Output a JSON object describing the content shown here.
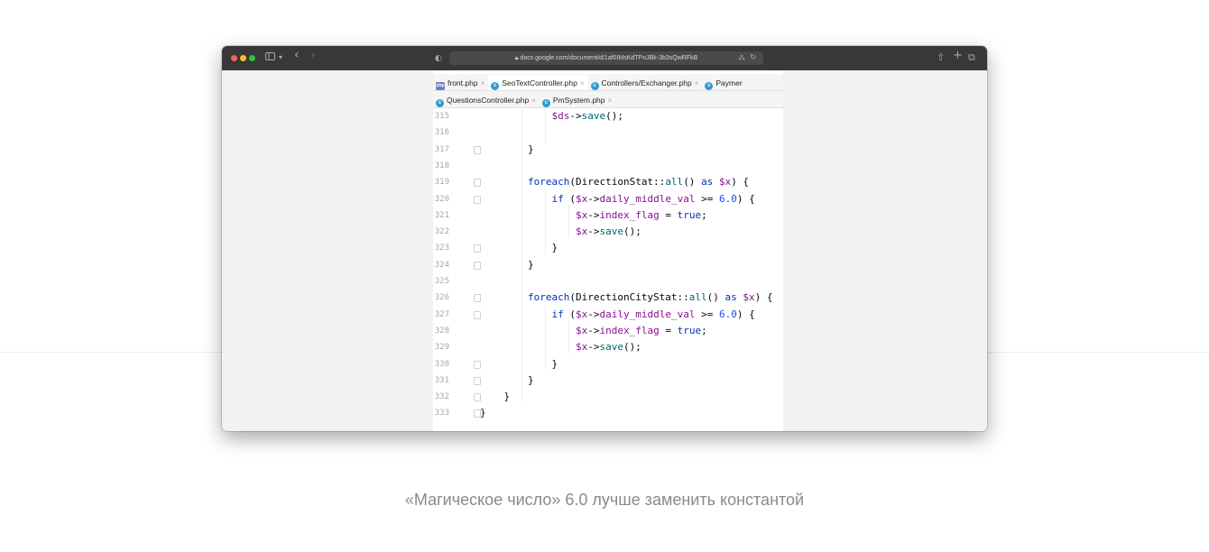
{
  "browser": {
    "url": "docs.google.com/document/d/1af0IMsKdTPoJBk-3b3sQwRFkB",
    "controls": {
      "sidebar_icon": "sidebar-icon",
      "chevron": "▾",
      "back": "‹",
      "forward": "›",
      "privacy": "◐",
      "translate": "⁂",
      "reload": "↻",
      "share": "⇪",
      "new_tab": "+",
      "tabs": "⧉"
    }
  },
  "ide": {
    "tabs_row1": [
      {
        "label": "front.php",
        "icon": "php-file-icon",
        "active": false
      },
      {
        "label": "SeoTextController.php",
        "icon": "class-icon",
        "active": true
      },
      {
        "label": "Controllers/Exchanger.php",
        "icon": "class-icon",
        "active": false
      },
      {
        "label": "Paymer",
        "icon": "class-icon",
        "active": false
      }
    ],
    "tabs_row2": [
      {
        "label": "QuestionsController.php",
        "icon": "class-icon",
        "active": false
      },
      {
        "label": "PmSystem.php",
        "icon": "class-icon",
        "active": false
      }
    ],
    "php_icon_text": "php",
    "class_icon_text": "c",
    "close_glyph": "×",
    "code_lines": [
      {
        "n": "315",
        "segs": [
          [
            "            ",
            ""
          ],
          [
            "$ds",
            "v"
          ],
          [
            "->",
            ""
          ],
          [
            "save",
            "m"
          ],
          [
            "();",
            ""
          ]
        ]
      },
      {
        "n": "316",
        "segs": []
      },
      {
        "n": "317",
        "segs": [
          [
            "        }",
            ""
          ]
        ]
      },
      {
        "n": "318",
        "segs": []
      },
      {
        "n": "319",
        "segs": [
          [
            "        ",
            ""
          ],
          [
            "foreach",
            "kw"
          ],
          [
            "(DirectionStat::",
            ""
          ],
          [
            "all",
            "m"
          ],
          [
            "() ",
            ""
          ],
          [
            "as",
            "kw"
          ],
          [
            " ",
            ""
          ],
          [
            "$x",
            "v"
          ],
          [
            ") {",
            ""
          ]
        ]
      },
      {
        "n": "320",
        "segs": [
          [
            "            ",
            ""
          ],
          [
            "if",
            "kw"
          ],
          [
            " (",
            ""
          ],
          [
            "$x",
            "v"
          ],
          [
            "->",
            ""
          ],
          [
            "daily_middle_val",
            "v"
          ],
          [
            " >= ",
            ""
          ],
          [
            "6.0",
            "n"
          ],
          [
            ") {",
            ""
          ]
        ]
      },
      {
        "n": "321",
        "segs": [
          [
            "                ",
            ""
          ],
          [
            "$x",
            "v"
          ],
          [
            "->",
            ""
          ],
          [
            "index_flag",
            "v"
          ],
          [
            " = ",
            ""
          ],
          [
            "true",
            "kw"
          ],
          [
            ";",
            ""
          ]
        ]
      },
      {
        "n": "322",
        "segs": [
          [
            "                ",
            ""
          ],
          [
            "$x",
            "v"
          ],
          [
            "->",
            ""
          ],
          [
            "save",
            "m"
          ],
          [
            "();",
            ""
          ]
        ]
      },
      {
        "n": "323",
        "segs": [
          [
            "            }",
            ""
          ]
        ]
      },
      {
        "n": "324",
        "segs": [
          [
            "        }",
            ""
          ]
        ]
      },
      {
        "n": "325",
        "segs": []
      },
      {
        "n": "326",
        "segs": [
          [
            "        ",
            ""
          ],
          [
            "foreach",
            "kw"
          ],
          [
            "(DirectionCityStat::",
            ""
          ],
          [
            "all",
            "m"
          ],
          [
            "() ",
            ""
          ],
          [
            "as",
            "kw"
          ],
          [
            " ",
            ""
          ],
          [
            "$x",
            "v"
          ],
          [
            ") {",
            ""
          ]
        ]
      },
      {
        "n": "327",
        "segs": [
          [
            "            ",
            ""
          ],
          [
            "if",
            "kw"
          ],
          [
            " (",
            ""
          ],
          [
            "$x",
            "v"
          ],
          [
            "->",
            ""
          ],
          [
            "daily_middle_val",
            "v"
          ],
          [
            " >= ",
            ""
          ],
          [
            "6.0",
            "n"
          ],
          [
            ") {",
            ""
          ]
        ]
      },
      {
        "n": "328",
        "segs": [
          [
            "                ",
            ""
          ],
          [
            "$x",
            "v"
          ],
          [
            "->",
            ""
          ],
          [
            "index_flag",
            "v"
          ],
          [
            " = ",
            ""
          ],
          [
            "true",
            "kw"
          ],
          [
            ";",
            ""
          ]
        ]
      },
      {
        "n": "329",
        "segs": [
          [
            "                ",
            ""
          ],
          [
            "$x",
            "v"
          ],
          [
            "->",
            ""
          ],
          [
            "save",
            "m"
          ],
          [
            "();",
            ""
          ]
        ]
      },
      {
        "n": "330",
        "segs": [
          [
            "            }",
            ""
          ]
        ]
      },
      {
        "n": "331",
        "segs": [
          [
            "        }",
            ""
          ]
        ]
      },
      {
        "n": "332",
        "segs": [
          [
            "    }",
            ""
          ]
        ]
      },
      {
        "n": "333",
        "segs": [
          [
            "}",
            ""
          ]
        ]
      }
    ],
    "colors": {
      "variable": "#871094",
      "method": "#00627a",
      "keyword": "#0033b3",
      "number": "#1750eb",
      "active_tab_underline": "#3d7ad8"
    }
  },
  "caption": "«Магическое число» 6.0 лучше заменить константой"
}
